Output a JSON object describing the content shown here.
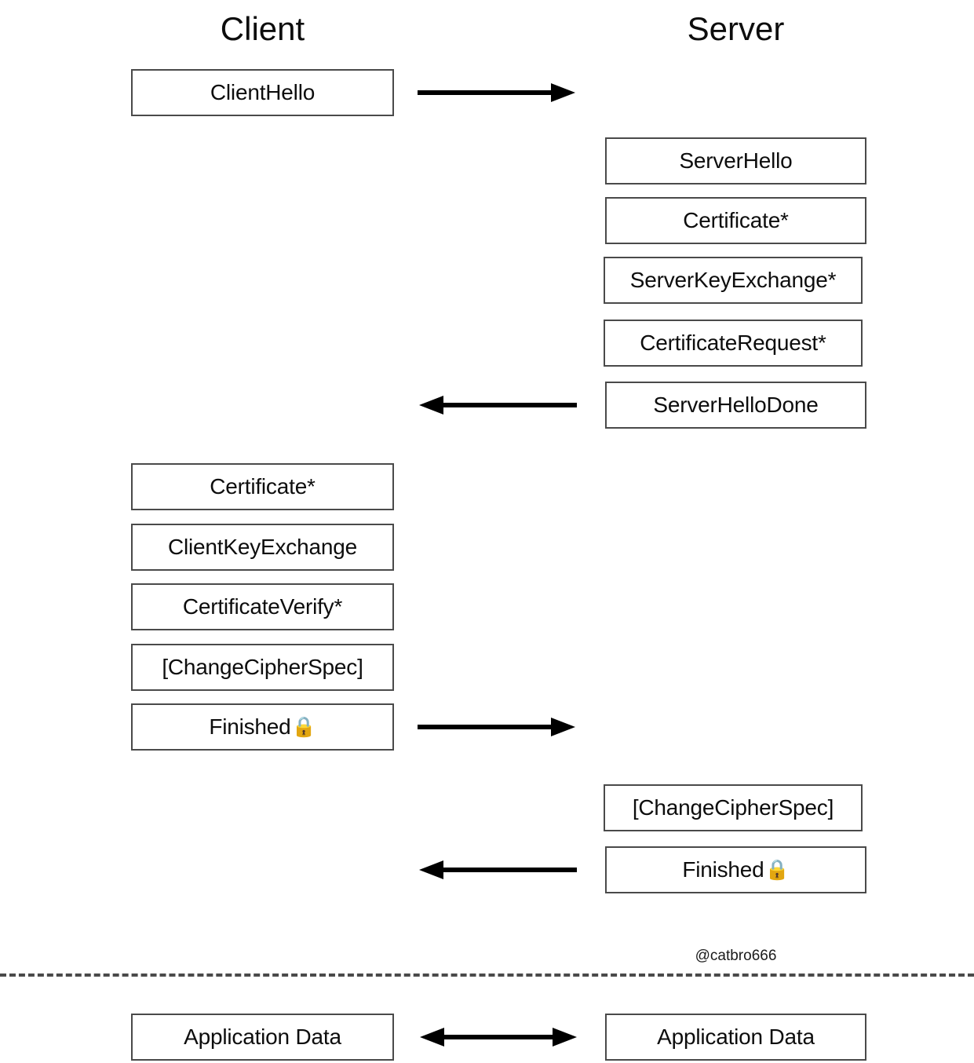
{
  "diagram": {
    "title_client": "Client",
    "title_server": "Server",
    "watermark": "@catbro666",
    "lock_glyph": "🔒",
    "colors": {
      "box_border": "#4a4a4a",
      "text": "#0d0d0d",
      "arrow": "#000000",
      "separator": "#4a4a4a",
      "background": "#ffffff"
    }
  },
  "client_messages": {
    "hello": "ClientHello",
    "certificate": "Certificate*",
    "client_key_exchange": "ClientKeyExchange",
    "certificate_verify": "CertificateVerify*",
    "change_cipher_spec": "[ChangeCipherSpec]",
    "finished": "Finished",
    "application_data": "Application Data"
  },
  "server_messages": {
    "hello": "ServerHello",
    "certificate": "Certificate*",
    "server_key_exchange": "ServerKeyExchange*",
    "certificate_request": "CertificateRequest*",
    "hello_done": "ServerHelloDone",
    "change_cipher_spec": "[ChangeCipherSpec]",
    "finished": "Finished",
    "application_data": "Application Data"
  }
}
